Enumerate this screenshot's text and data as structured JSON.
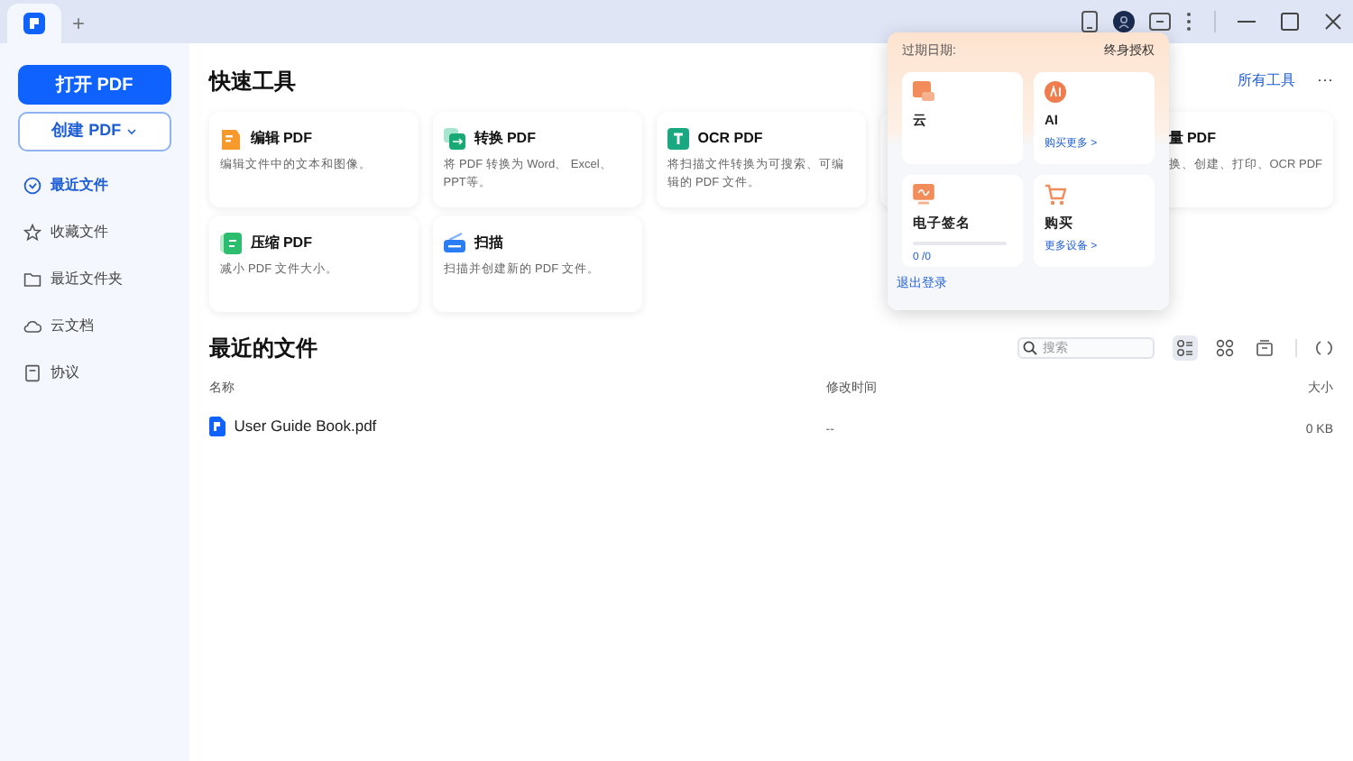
{
  "tabs": [
    {
      "kind": "app",
      "selected": true
    },
    {
      "kind": "new",
      "label": "+",
      "selected": false
    }
  ],
  "sidebar": {
    "primary_button": "打开 PDF",
    "create_button": "创建 PDF",
    "items": [
      {
        "label": "最近文件",
        "selected": true
      },
      {
        "label": "收藏文件",
        "selected": false
      },
      {
        "label": "最近文件夹",
        "selected": false
      },
      {
        "label": "云文档",
        "selected": false
      },
      {
        "label": "协议",
        "selected": false
      }
    ]
  },
  "quick_tools": {
    "title": "快速工具",
    "all_tools_link": "所有工具",
    "more": "···",
    "tools": [
      {
        "title": "编辑 PDF",
        "description": "编辑文件中的文本和图像。"
      },
      {
        "title": "转换 PDF",
        "description": "将 PDF 转换为 Word、 Excel、PPT等。"
      },
      {
        "title": "OCR PDF",
        "description": "将扫描文件转换为可搜索、可编辑的 PDF 文件。"
      },
      {
        "title": "量 PDF",
        "description": "换、创建、打印、OCR PDF"
      },
      {
        "title": "压缩 PDF",
        "description": "减小 PDF 文件大小。"
      },
      {
        "title": "扫描",
        "description": "扫描并创建新的 PDF 文件。"
      }
    ]
  },
  "recent_files": {
    "title": "最近的文件",
    "search": {
      "placeholder": "搜索"
    },
    "views": [
      {
        "selected": true
      },
      {
        "selected": false
      },
      {
        "selected": false
      }
    ],
    "columns": [
      "名称",
      "修改时间",
      "大小"
    ],
    "rows": [
      {
        "name": "User Guide Book.pdf",
        "modified": "--",
        "size": "0 KB"
      }
    ]
  },
  "account_popup": {
    "expiry_label": "过期日期:",
    "expiry_value": "终身授权",
    "tiles": [
      {
        "title": "云"
      },
      {
        "title": "AI",
        "link": "购买更多 >"
      },
      {
        "title": "电子签名",
        "level": 0,
        "reading": "0 /0"
      },
      {
        "title": "购买",
        "link": "更多设备 >"
      }
    ],
    "logout": "退出登录"
  }
}
